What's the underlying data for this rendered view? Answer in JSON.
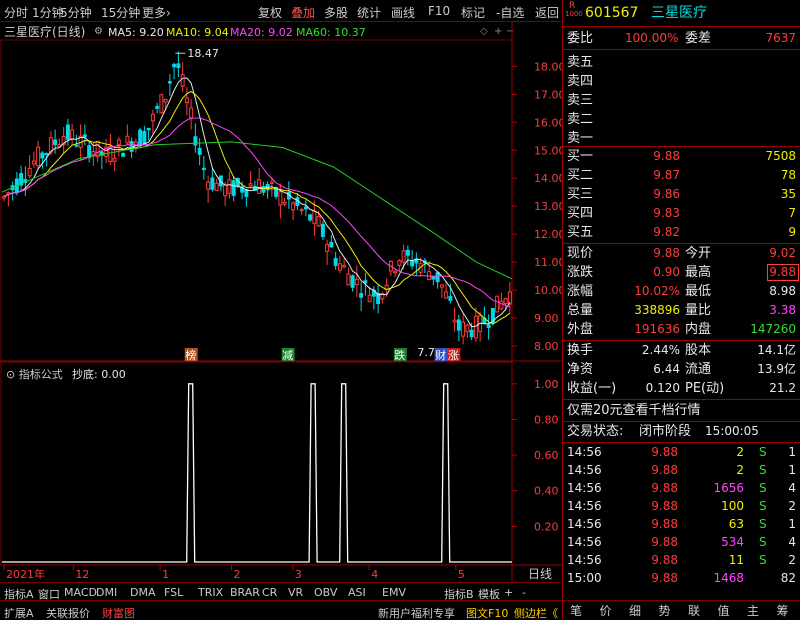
{
  "topbar": {
    "left": [
      "分时",
      "1分钟",
      "5分钟",
      "15分钟",
      "更多›"
    ],
    "right": [
      "复权",
      "叠加",
      "多股",
      "统计",
      "画线",
      "F10",
      "标记",
      "-自选",
      "返回"
    ]
  },
  "legend": {
    "title": "三星医疗(日线)",
    "ma5": "MA5: 9.20",
    "ma10": "MA10: 9.04",
    "ma20": "MA20: 9.02",
    "ma60": "MA60: 10.37"
  },
  "price_axis": [
    "18.00",
    "17.00",
    "16.00",
    "15.00",
    "14.00",
    "13.00",
    "12.00",
    "11.00",
    "10.00",
    "9.00",
    "8.00"
  ],
  "high_label": "18.47",
  "low_label": "7.78",
  "markers": [
    "榜",
    "减",
    "跌",
    "财",
    "涨"
  ],
  "indicator": {
    "label": "指标公式",
    "name": "抄底: 0.00",
    "axis": [
      "1.00",
      "0.80",
      "0.60",
      "0.40",
      "0.20"
    ]
  },
  "time_axis": [
    "2021年",
    "12",
    "1",
    "2",
    "3",
    "4",
    "5"
  ],
  "period": "日线",
  "indicator_tabs": [
    "指标A",
    "窗口",
    "MACD",
    "DMI",
    "DMA",
    "FSL",
    "TRIX",
    "BRAR",
    "CR",
    "VR",
    "OBV",
    "ASI",
    "EMV",
    "指标B",
    "模板",
    "+",
    "-"
  ],
  "bottom_left": [
    "扩展A",
    "关联报价",
    "财富图"
  ],
  "bottom_mid": [
    "新用户福利专享",
    "图文F10",
    "侧边栏《"
  ],
  "bottom_right": [
    "笔",
    "价",
    "细",
    "势",
    "联",
    "值",
    "主",
    "筹"
  ],
  "stock": {
    "code": "601567",
    "name": "三星医疗",
    "badge_top": "R",
    "badge_bot": "1000"
  },
  "weibi": {
    "label1": "委比",
    "value1": "100.00%",
    "label2": "委差",
    "value2": "7637"
  },
  "sell": [
    {
      "label": "卖五"
    },
    {
      "label": "卖四"
    },
    {
      "label": "卖三"
    },
    {
      "label": "卖二"
    },
    {
      "label": "卖一"
    }
  ],
  "buy": [
    {
      "label": "买一",
      "price": "9.88",
      "vol": "7508"
    },
    {
      "label": "买二",
      "price": "9.87",
      "vol": "78"
    },
    {
      "label": "买三",
      "price": "9.86",
      "vol": "35"
    },
    {
      "label": "买四",
      "price": "9.83",
      "vol": "7"
    },
    {
      "label": "买五",
      "price": "9.82",
      "vol": "9"
    }
  ],
  "quote": [
    {
      "l1": "现价",
      "v1": "9.88",
      "l2": "今开",
      "v2": "9.02"
    },
    {
      "l1": "涨跌",
      "v1": "0.90",
      "l2": "最高",
      "v2": "9.88"
    },
    {
      "l1": "涨幅",
      "v1": "10.02%",
      "l2": "最低",
      "v2": "8.98"
    },
    {
      "l1": "总量",
      "v1": "338896",
      "l2": "量比",
      "v2": "3.38"
    },
    {
      "l1": "外盘",
      "v1": "191636",
      "l2": "内盘",
      "v2": "147260"
    }
  ],
  "fund": [
    {
      "l1": "换手",
      "v1": "2.44%",
      "l2": "股本",
      "v2": "14.1亿"
    },
    {
      "l1": "净资",
      "v1": "6.44",
      "l2": "流通",
      "v2": "13.9亿"
    },
    {
      "l1": "收益(一)",
      "v1": "0.120",
      "l2": "PE(动)",
      "v2": "21.2"
    }
  ],
  "promo": "仅需20元查看千档行情",
  "status": {
    "label": "交易状态:",
    "value": "闭市阶段",
    "time": "15:00:05"
  },
  "ticks": [
    {
      "t": "14:56",
      "p": "9.88",
      "v": "2",
      "d": "S",
      "n": "1"
    },
    {
      "t": "14:56",
      "p": "9.88",
      "v": "2",
      "d": "S",
      "n": "1"
    },
    {
      "t": "14:56",
      "p": "9.88",
      "v": "1656",
      "d": "S",
      "n": "4"
    },
    {
      "t": "14:56",
      "p": "9.88",
      "v": "100",
      "d": "S",
      "n": "2"
    },
    {
      "t": "14:56",
      "p": "9.88",
      "v": "63",
      "d": "S",
      "n": "1"
    },
    {
      "t": "14:56",
      "p": "9.88",
      "v": "534",
      "d": "S",
      "n": "4"
    },
    {
      "t": "14:56",
      "p": "9.88",
      "v": "11",
      "d": "S",
      "n": "2"
    },
    {
      "t": "15:00",
      "p": "9.88",
      "v": "1468",
      "d": "",
      "n": "82"
    }
  ],
  "chart_data": {
    "type": "candlestick",
    "ylim": [
      7.5,
      18.8
    ],
    "indicator_ylim": [
      0,
      1.1
    ],
    "indicator_signals": [
      0.37,
      0.61,
      0.67,
      0.87
    ],
    "ma60_path": [
      [
        0,
        13.5
      ],
      [
        0.15,
        14.7
      ],
      [
        0.3,
        15.2
      ],
      [
        0.45,
        15.3
      ],
      [
        0.55,
        15.1
      ],
      [
        0.65,
        14.4
      ],
      [
        0.75,
        13.2
      ],
      [
        0.85,
        12.0
      ],
      [
        0.93,
        11.0
      ],
      [
        1.0,
        10.4
      ]
    ]
  }
}
